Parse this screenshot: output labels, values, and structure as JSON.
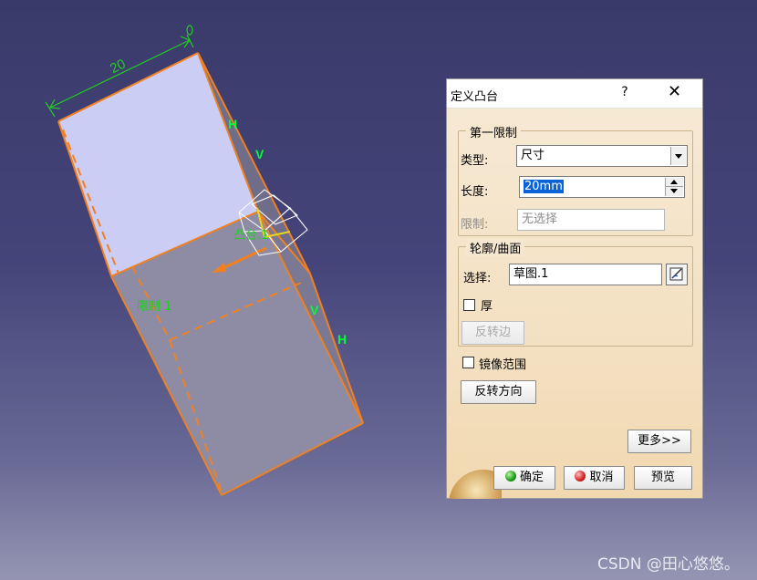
{
  "viewport": {
    "dimension_value": "20",
    "labels": {
      "h_top": "H",
      "v_top": "V",
      "v_right": "V",
      "h_right": "H",
      "pad_label": "凸台.1",
      "limit_label": "限制 1"
    },
    "colors": {
      "edge": "#f08020",
      "dimension": "#22cc22",
      "face_light": "#cccdf5",
      "face_dark": "#8e8ca5"
    }
  },
  "dialog": {
    "title": "定义凸台",
    "help_label": "?",
    "close_label": "✕",
    "first_limit": {
      "group_title": "第一限制",
      "type_label": "类型:",
      "type_value": "尺寸",
      "length_label": "长度:",
      "length_value": "20mm",
      "limit_label": "限制:",
      "limit_value": "无选择"
    },
    "profile": {
      "group_title": "轮廓/曲面",
      "select_label": "选择:",
      "select_value": "草图.1",
      "thick_label": "厚",
      "reverse_side_label": "反转边"
    },
    "mirror_label": "镜像范围",
    "reverse_direction_label": "反转方向",
    "more_label": "更多>>",
    "ok_label": "确定",
    "cancel_label": "取消",
    "preview_label": "预览"
  },
  "watermark": "CSDN @田心悠悠。"
}
